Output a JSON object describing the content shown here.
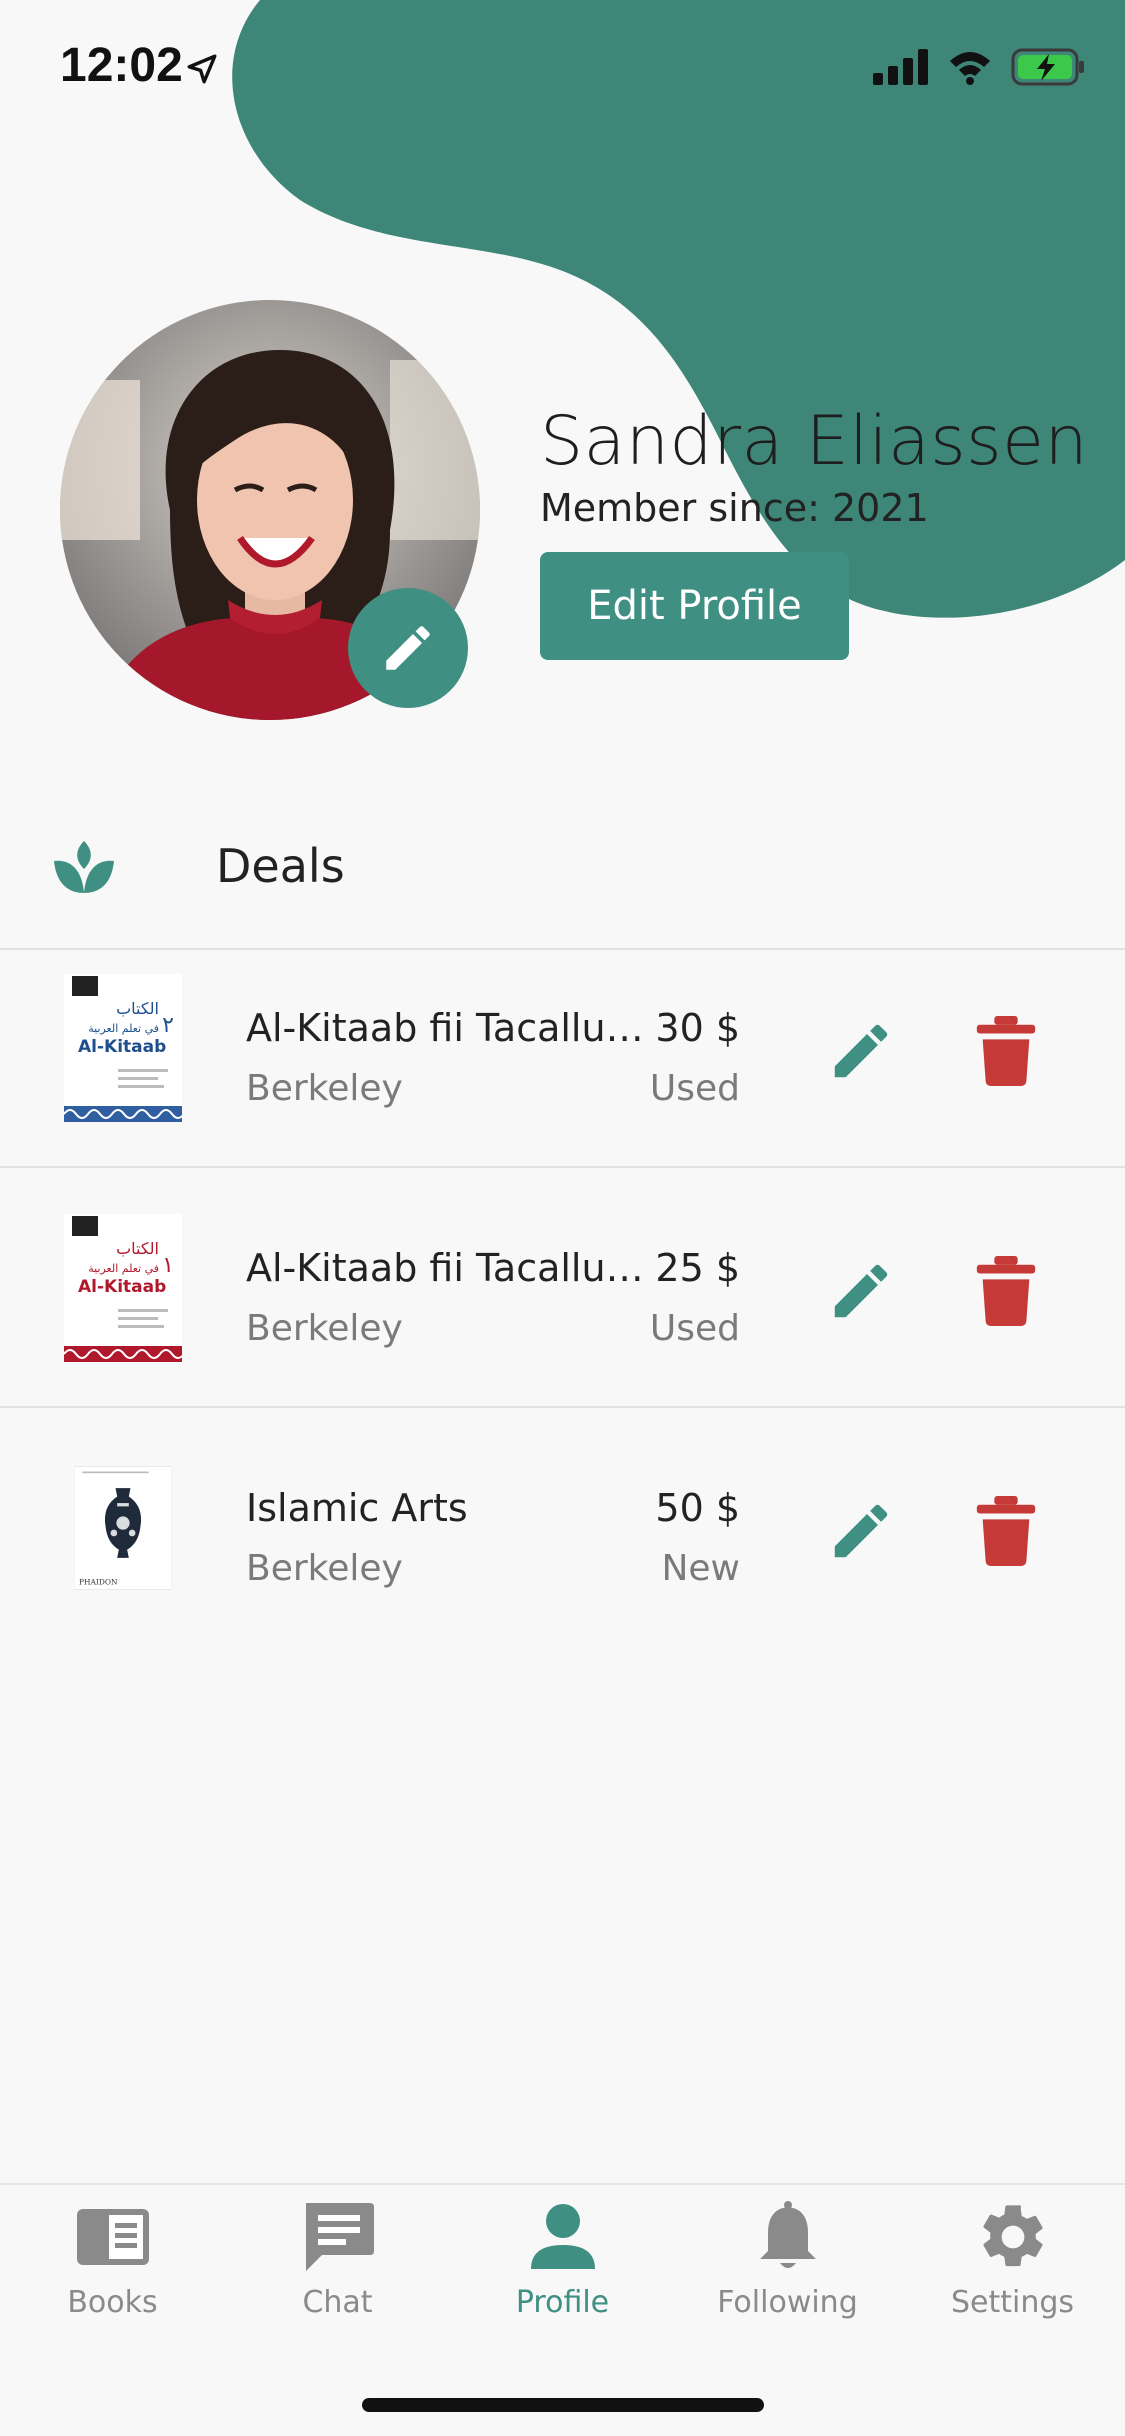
{
  "status_bar": {
    "time": "12:02"
  },
  "profile": {
    "name": "Sandra Eliassen",
    "member_since": "Member since: 2021",
    "edit_button_label": "Edit Profile"
  },
  "deals": {
    "title": "Deals",
    "items": [
      {
        "title": "Al-Kitaab fii Tacallum ...",
        "price": "30 $",
        "city": "Berkeley",
        "condition": "Used",
        "cover_text_ar": "الكتاب",
        "cover_sub_ar": "في تعلم العربية",
        "cover_brand": "Al-Kitaab",
        "cover_vol": "٢"
      },
      {
        "title": "Al-Kitaab fii Tacallum ...",
        "price": "25 $",
        "city": "Berkeley",
        "condition": "Used",
        "cover_text_ar": "الكتاب",
        "cover_sub_ar": "في تعلم العربية",
        "cover_brand": "Al-Kitaab",
        "cover_vol": "١"
      },
      {
        "title": "Islamic Arts",
        "price": "50 $",
        "city": "Berkeley",
        "condition": "New",
        "cover_brand": "PHAIDON"
      }
    ]
  },
  "tabbar": {
    "items": [
      {
        "label": "Books",
        "icon": "book-icon"
      },
      {
        "label": "Chat",
        "icon": "chat-icon"
      },
      {
        "label": "Profile",
        "icon": "person-icon"
      },
      {
        "label": "Following",
        "icon": "bell-icon"
      },
      {
        "label": "Settings",
        "icon": "gear-icon"
      }
    ],
    "active": "Profile"
  },
  "colors": {
    "accent": "#3f8f83",
    "delete": "#c53a36",
    "background": "#f8f8f8"
  }
}
